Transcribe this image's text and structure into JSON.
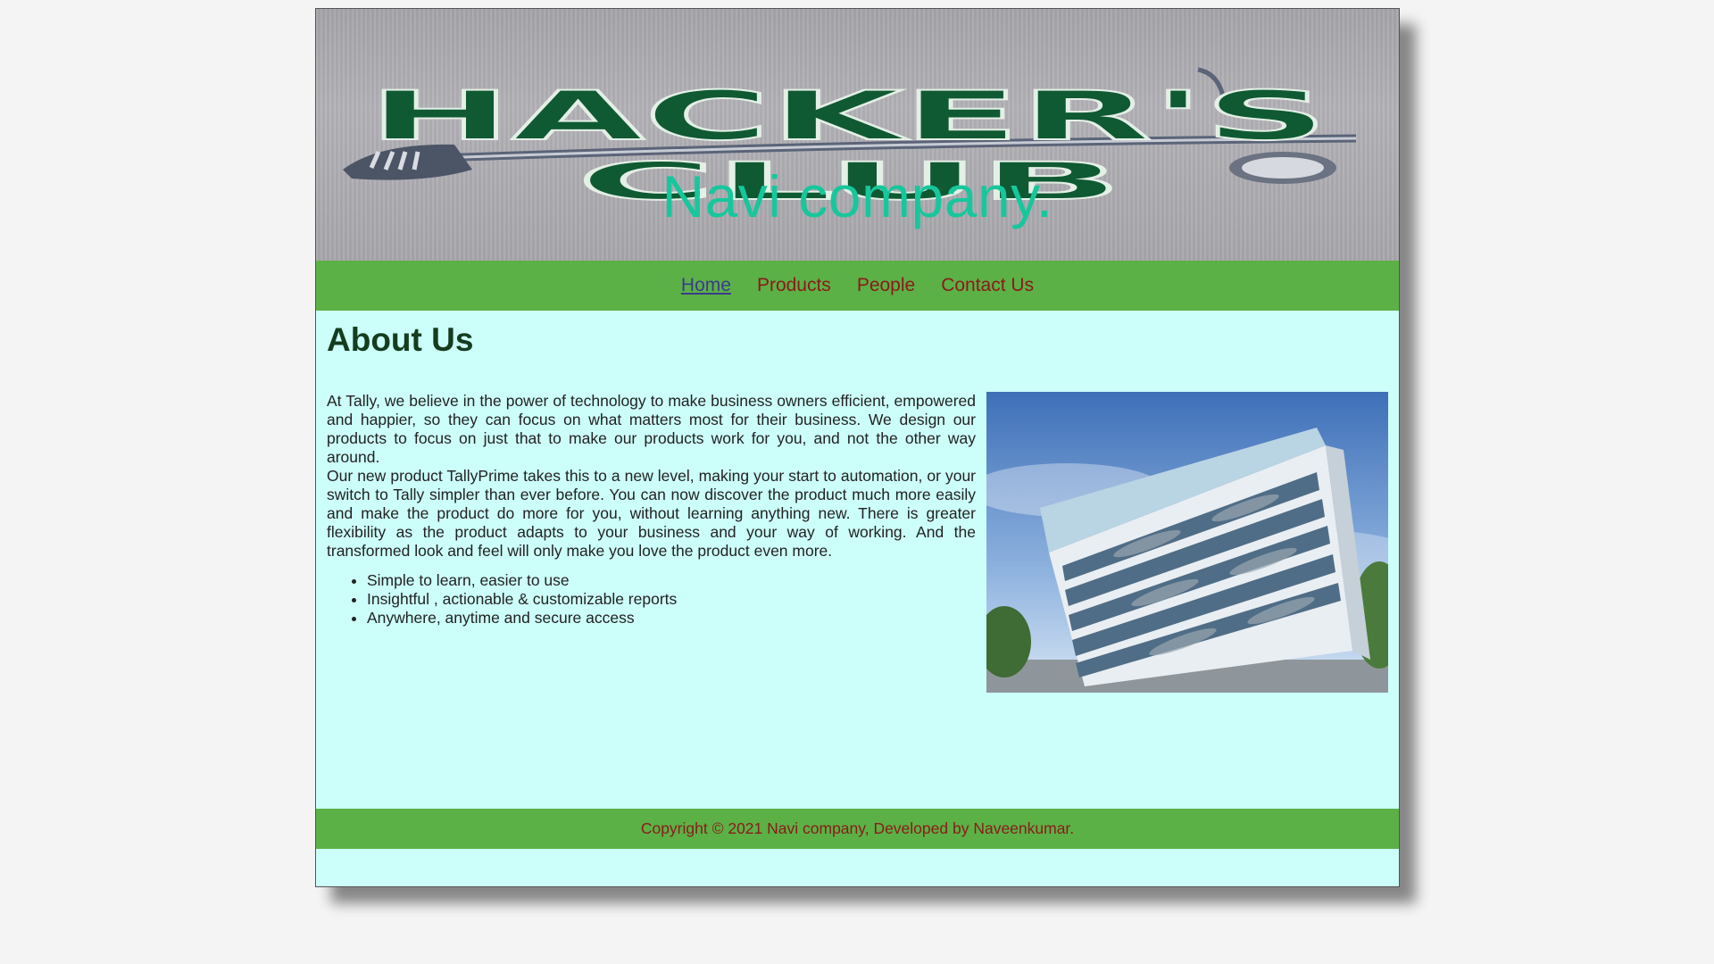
{
  "banner": {
    "logo_line1": "HACKER'S",
    "logo_line2": "CLUB",
    "company": "Navi company."
  },
  "nav": {
    "items": [
      {
        "label": "Home",
        "active": true
      },
      {
        "label": "Products"
      },
      {
        "label": "People"
      },
      {
        "label": "Contact Us"
      }
    ]
  },
  "main": {
    "heading": "About Us",
    "paragraph1": "At Tally, we believe in the power of technology to make business owners efficient, empowered and happier, so they can focus on what matters most for their business. We design our products to focus on just that to make our products work for you, and not the other way around.",
    "paragraph2": "Our new product TallyPrime takes this to a new level, making your start to automation, or your switch to Tally simpler than ever before. You can now discover the product much more easily and make the product do more for you, without learning anything new. There is greater flexibility as the product adapts to your business and your way of working. And the transformed look and feel will only make you love the product even more.",
    "features": [
      "Simple to learn, easier to use",
      "Insightful , actionable & customizable reports",
      "Anywhere, anytime and secure access"
    ]
  },
  "footer": {
    "text": "Copyright © 2021 Navi company, Developed by Naveenkumar."
  },
  "colors": {
    "background": "#f4f4f4",
    "content_bg": "#ccfffa",
    "nav_bg": "#5bb145",
    "link": "#8b1a1a",
    "active_link": "#3b3a8f",
    "company": "#17c79b",
    "logo_green": "#0f5a33"
  }
}
